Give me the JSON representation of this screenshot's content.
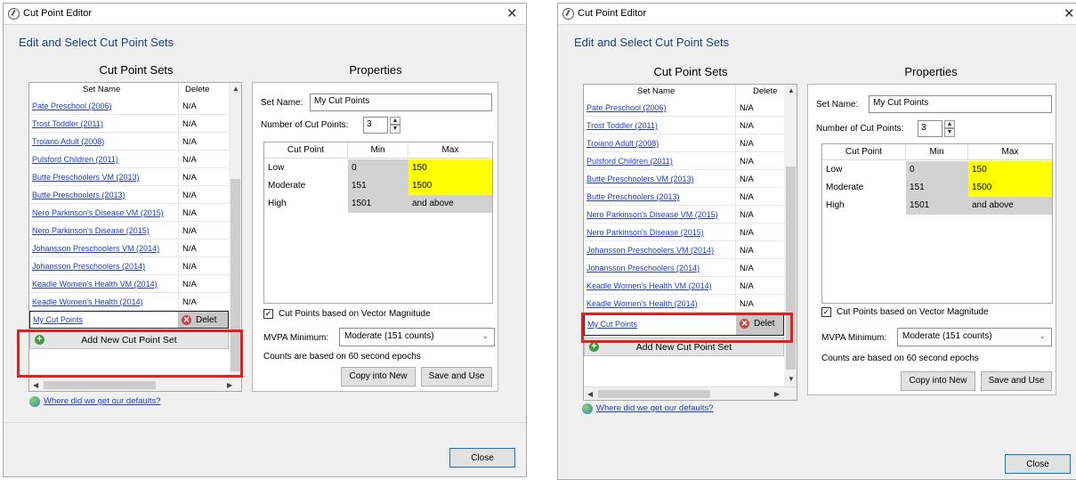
{
  "window": {
    "title": "Cut Point Editor",
    "close_glyph": "✕"
  },
  "heading": "Edit and Select Cut Point Sets",
  "sets": {
    "title": "Cut Point Sets",
    "col_name": "Set Name",
    "col_delete": "Delete",
    "rows": [
      {
        "name": "Pate Preschool (2006)",
        "delete": "N/A"
      },
      {
        "name": "Trost Toddler (2011)",
        "delete": "N/A"
      },
      {
        "name": "Troiano Adult (2008)",
        "delete": "N/A"
      },
      {
        "name": "Pulsford Children (2011)",
        "delete": "N/A"
      },
      {
        "name": "Butte Preschoolers VM (2013)",
        "delete": "N/A"
      },
      {
        "name": "Butte Preschoolers (2013)",
        "delete": "N/A"
      },
      {
        "name": "Nero Parkinson's Disease VM (2015)",
        "delete": "N/A"
      },
      {
        "name": "Nero Parkinson's Disease (2015)",
        "delete": "N/A"
      },
      {
        "name": "Johansson Preschoolers VM (2014)",
        "delete": "N/A"
      },
      {
        "name": "Johansson Preschoolers (2014)",
        "delete": "N/A"
      },
      {
        "name": "Keadle Women's Health VM (2014)",
        "delete": "N/A"
      },
      {
        "name": "Keadle Women's Health (2014)",
        "delete": "N/A"
      }
    ],
    "selected": {
      "name": "My Cut Points",
      "delete_left": "Delet",
      "delete_right": "Delet"
    },
    "add_label": "Add New Cut Point Set",
    "defaults_link": "Where did we get our defaults?"
  },
  "properties": {
    "title": "Properties",
    "set_name_label": "Set Name:",
    "set_name_value": "My Cut Points",
    "num_label": "Number of Cut Points:",
    "num_value": "3",
    "grid_headers": [
      "Cut Point",
      "Min",
      "Max"
    ],
    "grid_rows": [
      {
        "cut": "Low",
        "min": "0",
        "max": "150"
      },
      {
        "cut": "Moderate",
        "min": "151",
        "max": "1500"
      },
      {
        "cut": "High",
        "min": "1501",
        "max": "and above"
      }
    ],
    "vm_label": "Cut Points based on Vector Magnitude",
    "vm_checked": "✓",
    "mvpa_label": "MVPA Minimum:",
    "mvpa_value": "Moderate (151 counts)",
    "epochs_note": "Counts are based on 60 second epochs",
    "copy_button": "Copy into New",
    "save_button": "Save and Use"
  },
  "close_button": "Close",
  "colors": {
    "highlight": "#e22020",
    "yellow": "#ffff00",
    "link": "#1f3ec0",
    "heading": "#1a3f7d"
  }
}
